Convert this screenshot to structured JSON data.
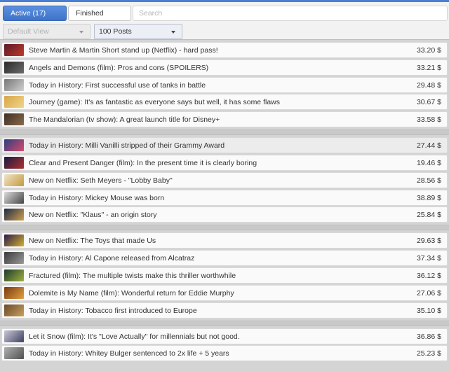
{
  "header": {
    "tabs": [
      {
        "label": "Active (17)",
        "active": true
      },
      {
        "label": "Finished",
        "active": false
      }
    ],
    "search_placeholder": "Search",
    "view_select": "Default View",
    "posts_select": "100 Posts"
  },
  "colors": {
    "accent": "#4a7fd4",
    "tab_active": "#4a7fd4",
    "row_bg": "#fafafa"
  },
  "groups": [
    [
      {
        "title": "Steve Martin & Martin Short stand up (Netflix) - hard pass!",
        "amount": "33.20 $",
        "thumb": [
          "#5a1a28",
          "#c0392b"
        ]
      },
      {
        "title": "Angels and Demons (film): Pros and cons (SPOILERS)",
        "amount": "33.21 $",
        "thumb": [
          "#2a2a2a",
          "#6b6b6b"
        ]
      },
      {
        "title": "Today in History: First successful use of tanks in battle",
        "amount": "29.48 $",
        "thumb": [
          "#777777",
          "#cfcfcf"
        ]
      },
      {
        "title": "Journey (game): It's as fantastic as everyone says but well, it has some flaws",
        "amount": "30.67 $",
        "thumb": [
          "#d9a64a",
          "#f0d488"
        ]
      },
      {
        "title": "The Mandalorian (tv show): A great launch title for Disney+",
        "amount": "33.58 $",
        "thumb": [
          "#3d2f24",
          "#8a6a4a"
        ]
      }
    ],
    [
      {
        "title": "Today in History: Milli Vanilli stripped of their Grammy Award",
        "amount": "27.44 $",
        "thumb": [
          "#2c3e80",
          "#d84a6a"
        ],
        "highlight": true
      },
      {
        "title": "Clear and Present Danger (film): In the present time it is clearly boring",
        "amount": "19.46 $",
        "thumb": [
          "#1a1a40",
          "#b03030"
        ]
      },
      {
        "title": "New on Netflix: Seth Meyers - \"Lobby Baby\"",
        "amount": "28.56 $",
        "thumb": [
          "#f0e4c8",
          "#c49a40"
        ]
      },
      {
        "title": "Today in History: Mickey Mouse was born",
        "amount": "38.89 $",
        "thumb": [
          "#dddddd",
          "#444444"
        ]
      },
      {
        "title": "New on Netflix: \"Klaus\" - an origin story",
        "amount": "25.84 $",
        "thumb": [
          "#1d2a44",
          "#d0a050"
        ]
      }
    ],
    [
      {
        "title": "New on Netflix: The Toys that made Us",
        "amount": "29.63 $",
        "thumb": [
          "#2a1a4a",
          "#d4b030"
        ]
      },
      {
        "title": "Today in History: Al Capone released from Alcatraz",
        "amount": "37.34 $",
        "thumb": [
          "#3a3a3a",
          "#9a9a9a"
        ]
      },
      {
        "title": "Fractured (film): The multiple twists make this thriller worthwhile",
        "amount": "36.12 $",
        "thumb": [
          "#1a3a2a",
          "#a0b040"
        ]
      },
      {
        "title": "Dolemite is My Name (film): Wonderful return for Eddie Murphy",
        "amount": "27.06 $",
        "thumb": [
          "#7a3a10",
          "#e0a040"
        ]
      },
      {
        "title": "Today in History: Tobacco first introduced to Europe",
        "amount": "35.10 $",
        "thumb": [
          "#6a4a2a",
          "#c8a060"
        ]
      }
    ],
    [
      {
        "title": "Let it Snow (film): It's \"Love Actually\" for millennials but not good.",
        "amount": "36.86 $",
        "thumb": [
          "#c8c8d8",
          "#404060"
        ]
      },
      {
        "title": "Today in History: Whitey Bulger sentenced to 2x life + 5 years",
        "amount": "25.23 $",
        "thumb": [
          "#b0b0b0",
          "#505050"
        ]
      }
    ]
  ]
}
